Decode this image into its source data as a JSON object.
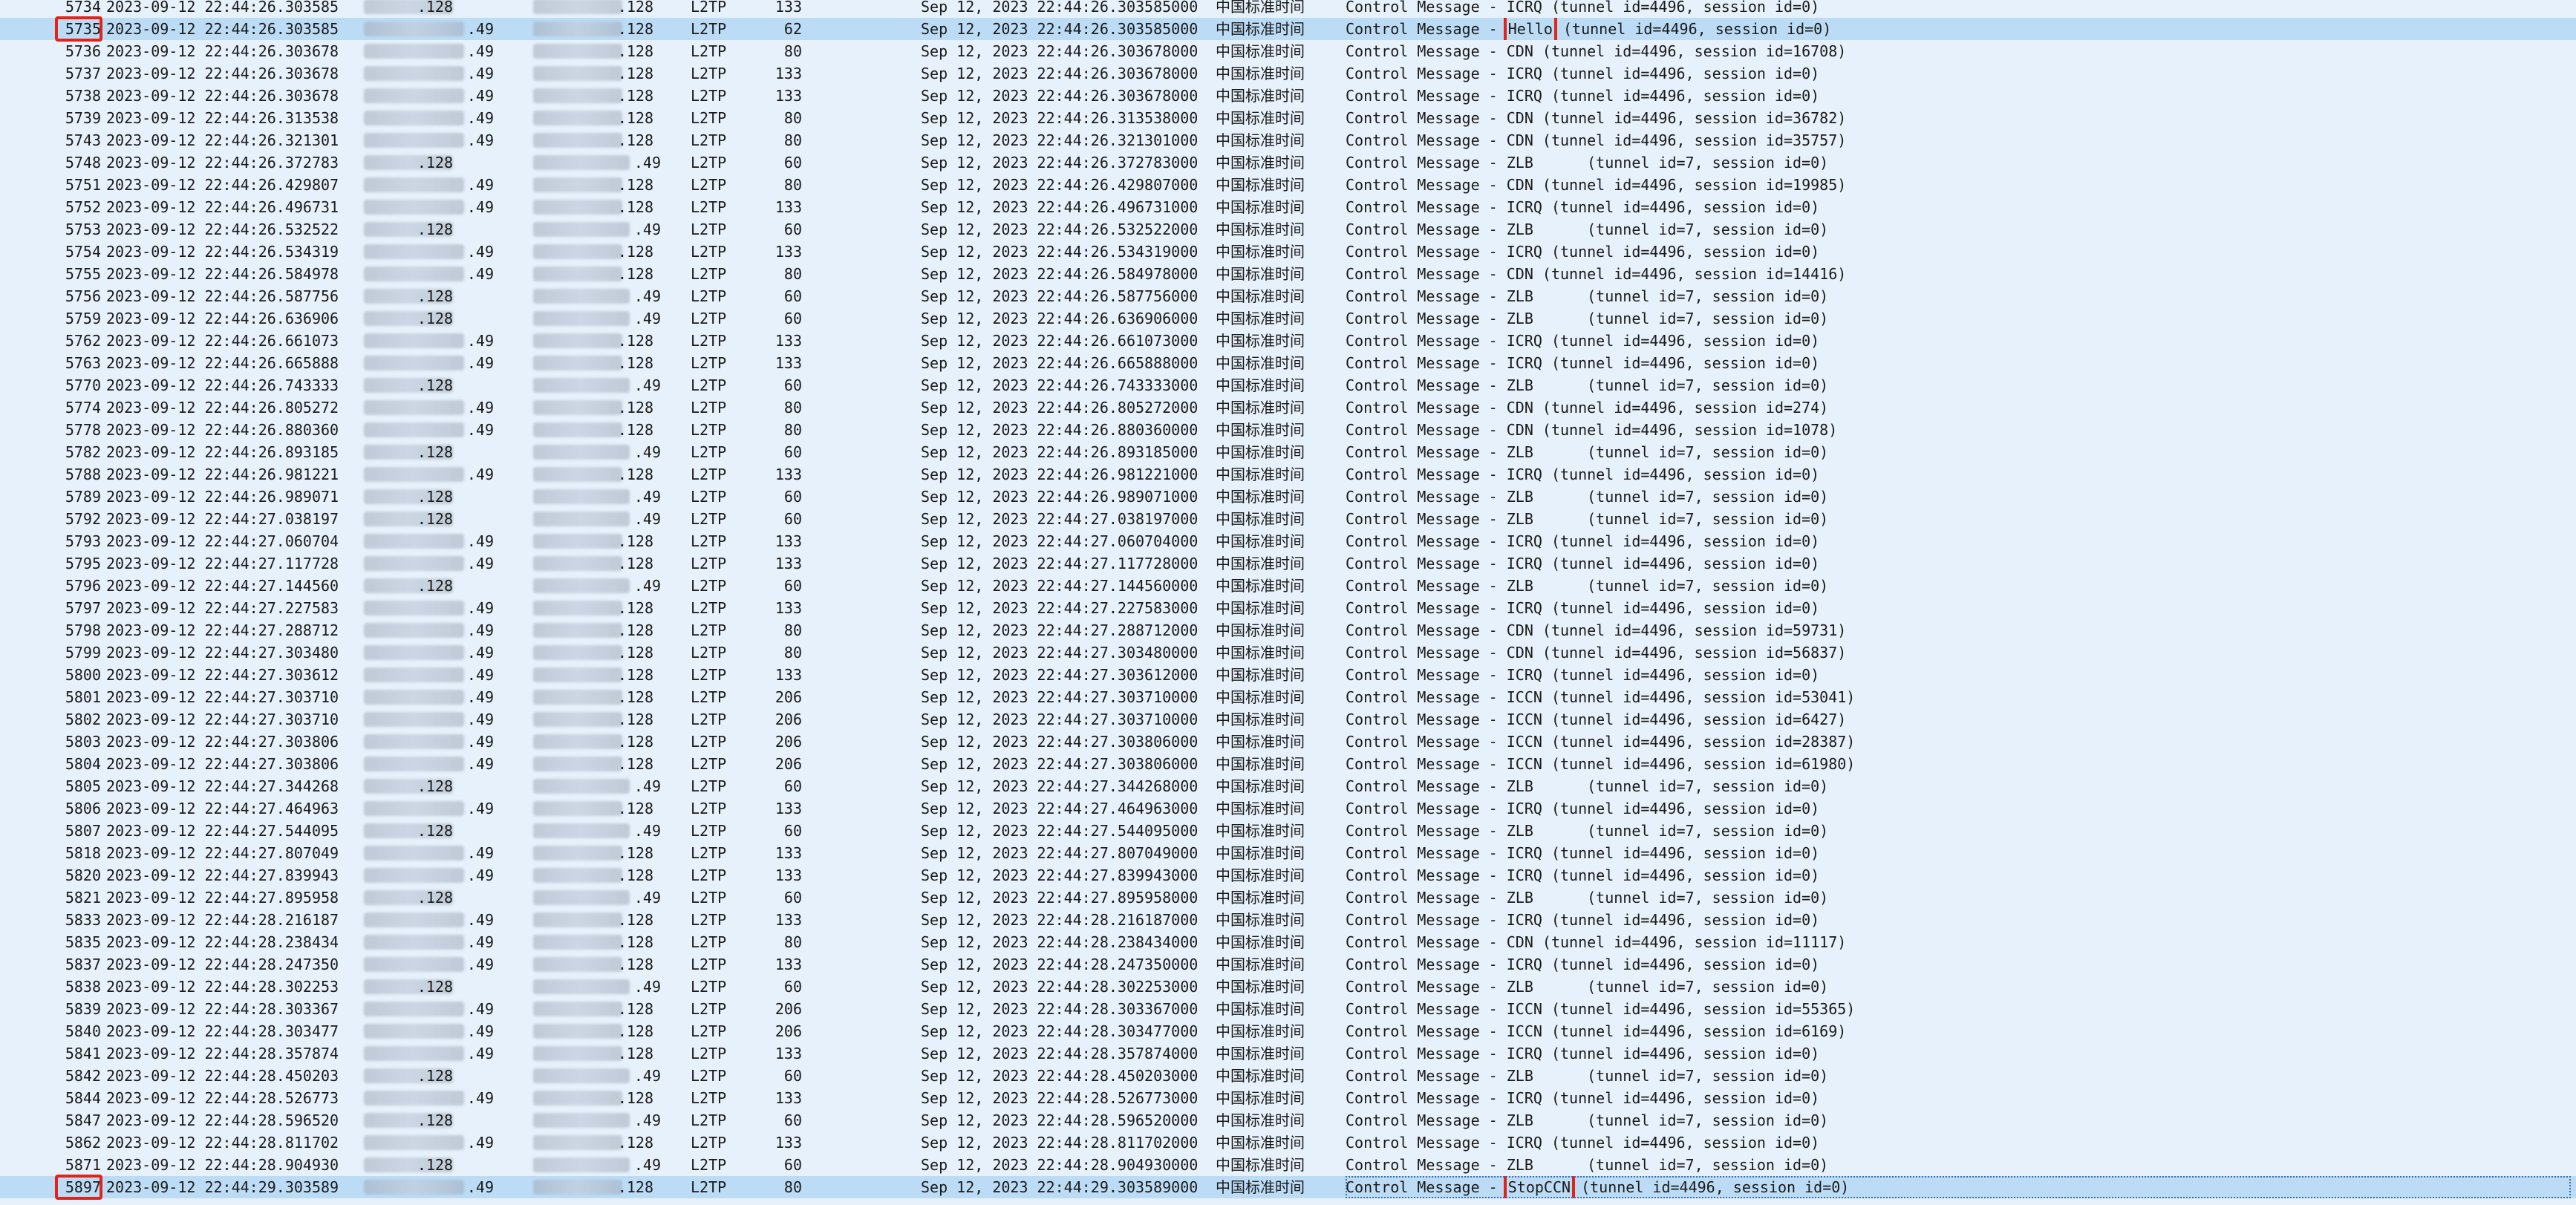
{
  "colors": {
    "background": "#e7f1fb",
    "selected_row": "#bcdcf6",
    "highlight_box": "#e2231a"
  },
  "common": {
    "protocol": "L2TP",
    "timezone": "中国标准时间",
    "date_prefix": "2023-09-12",
    "abs_prefix": "Sep 12, 2023"
  },
  "highlights": {
    "hello_message": "Hello",
    "stopccn_message": "StopCCN"
  },
  "rows": [
    {
      "no": "5734",
      "time": "2023-09-12 22:44:26.303585",
      "src": ".128",
      "dst": ".128",
      "proto": "L2TP",
      "len": "133",
      "abs": "Sep 12, 2023 22:44:26.303585000",
      "tz": "中国标准时间",
      "info": "Control Message - ICRQ (tunnel id=4496, session id=0)"
    },
    {
      "no": "5735",
      "time": "2023-09-12 22:44:26.303585",
      "src": ".49",
      "dst": ".128",
      "proto": "L2TP",
      "len": "62",
      "abs": "Sep 12, 2023 22:44:26.303585000",
      "tz": "中国标准时间",
      "info": "Control Message - Hello (tunnel id=4496, session id=0)"
    },
    {
      "no": "5736",
      "time": "2023-09-12 22:44:26.303678",
      "src": ".49",
      "dst": ".128",
      "proto": "L2TP",
      "len": "80",
      "abs": "Sep 12, 2023 22:44:26.303678000",
      "tz": "中国标准时间",
      "info": "Control Message - CDN (tunnel id=4496, session id=16708)"
    },
    {
      "no": "5737",
      "time": "2023-09-12 22:44:26.303678",
      "src": ".49",
      "dst": ".128",
      "proto": "L2TP",
      "len": "133",
      "abs": "Sep 12, 2023 22:44:26.303678000",
      "tz": "中国标准时间",
      "info": "Control Message - ICRQ (tunnel id=4496, session id=0)"
    },
    {
      "no": "5738",
      "time": "2023-09-12 22:44:26.303678",
      "src": ".49",
      "dst": ".128",
      "proto": "L2TP",
      "len": "133",
      "abs": "Sep 12, 2023 22:44:26.303678000",
      "tz": "中国标准时间",
      "info": "Control Message - ICRQ (tunnel id=4496, session id=0)"
    },
    {
      "no": "5739",
      "time": "2023-09-12 22:44:26.313538",
      "src": ".49",
      "dst": ".128",
      "proto": "L2TP",
      "len": "80",
      "abs": "Sep 12, 2023 22:44:26.313538000",
      "tz": "中国标准时间",
      "info": "Control Message - CDN (tunnel id=4496, session id=36782)"
    },
    {
      "no": "5743",
      "time": "2023-09-12 22:44:26.321301",
      "src": ".49",
      "dst": ".128",
      "proto": "L2TP",
      "len": "80",
      "abs": "Sep 12, 2023 22:44:26.321301000",
      "tz": "中国标准时间",
      "info": "Control Message - CDN (tunnel id=4496, session id=35757)"
    },
    {
      "no": "5748",
      "time": "2023-09-12 22:44:26.372783",
      "src": ".128",
      "dst": ".49",
      "proto": "L2TP",
      "len": "60",
      "abs": "Sep 12, 2023 22:44:26.372783000",
      "tz": "中国标准时间",
      "info": "Control Message - ZLB      (tunnel id=7, session id=0)"
    },
    {
      "no": "5751",
      "time": "2023-09-12 22:44:26.429807",
      "src": ".49",
      "dst": ".128",
      "proto": "L2TP",
      "len": "80",
      "abs": "Sep 12, 2023 22:44:26.429807000",
      "tz": "中国标准时间",
      "info": "Control Message - CDN (tunnel id=4496, session id=19985)"
    },
    {
      "no": "5752",
      "time": "2023-09-12 22:44:26.496731",
      "src": ".49",
      "dst": ".128",
      "proto": "L2TP",
      "len": "133",
      "abs": "Sep 12, 2023 22:44:26.496731000",
      "tz": "中国标准时间",
      "info": "Control Message - ICRQ (tunnel id=4496, session id=0)"
    },
    {
      "no": "5753",
      "time": "2023-09-12 22:44:26.532522",
      "src": ".128",
      "dst": ".49",
      "proto": "L2TP",
      "len": "60",
      "abs": "Sep 12, 2023 22:44:26.532522000",
      "tz": "中国标准时间",
      "info": "Control Message - ZLB      (tunnel id=7, session id=0)"
    },
    {
      "no": "5754",
      "time": "2023-09-12 22:44:26.534319",
      "src": ".49",
      "dst": ".128",
      "proto": "L2TP",
      "len": "133",
      "abs": "Sep 12, 2023 22:44:26.534319000",
      "tz": "中国标准时间",
      "info": "Control Message - ICRQ (tunnel id=4496, session id=0)"
    },
    {
      "no": "5755",
      "time": "2023-09-12 22:44:26.584978",
      "src": ".49",
      "dst": ".128",
      "proto": "L2TP",
      "len": "80",
      "abs": "Sep 12, 2023 22:44:26.584978000",
      "tz": "中国标准时间",
      "info": "Control Message - CDN (tunnel id=4496, session id=14416)"
    },
    {
      "no": "5756",
      "time": "2023-09-12 22:44:26.587756",
      "src": ".128",
      "dst": ".49",
      "proto": "L2TP",
      "len": "60",
      "abs": "Sep 12, 2023 22:44:26.587756000",
      "tz": "中国标准时间",
      "info": "Control Message - ZLB      (tunnel id=7, session id=0)"
    },
    {
      "no": "5759",
      "time": "2023-09-12 22:44:26.636906",
      "src": ".128",
      "dst": ".49",
      "proto": "L2TP",
      "len": "60",
      "abs": "Sep 12, 2023 22:44:26.636906000",
      "tz": "中国标准时间",
      "info": "Control Message - ZLB      (tunnel id=7, session id=0)"
    },
    {
      "no": "5762",
      "time": "2023-09-12 22:44:26.661073",
      "src": ".49",
      "dst": ".128",
      "proto": "L2TP",
      "len": "133",
      "abs": "Sep 12, 2023 22:44:26.661073000",
      "tz": "中国标准时间",
      "info": "Control Message - ICRQ (tunnel id=4496, session id=0)"
    },
    {
      "no": "5763",
      "time": "2023-09-12 22:44:26.665888",
      "src": ".49",
      "dst": ".128",
      "proto": "L2TP",
      "len": "133",
      "abs": "Sep 12, 2023 22:44:26.665888000",
      "tz": "中国标准时间",
      "info": "Control Message - ICRQ (tunnel id=4496, session id=0)"
    },
    {
      "no": "5770",
      "time": "2023-09-12 22:44:26.743333",
      "src": ".128",
      "dst": ".49",
      "proto": "L2TP",
      "len": "60",
      "abs": "Sep 12, 2023 22:44:26.743333000",
      "tz": "中国标准时间",
      "info": "Control Message - ZLB      (tunnel id=7, session id=0)"
    },
    {
      "no": "5774",
      "time": "2023-09-12 22:44:26.805272",
      "src": ".49",
      "dst": ".128",
      "proto": "L2TP",
      "len": "80",
      "abs": "Sep 12, 2023 22:44:26.805272000",
      "tz": "中国标准时间",
      "info": "Control Message - CDN (tunnel id=4496, session id=274)"
    },
    {
      "no": "5778",
      "time": "2023-09-12 22:44:26.880360",
      "src": ".49",
      "dst": ".128",
      "proto": "L2TP",
      "len": "80",
      "abs": "Sep 12, 2023 22:44:26.880360000",
      "tz": "中国标准时间",
      "info": "Control Message - CDN (tunnel id=4496, session id=1078)"
    },
    {
      "no": "5782",
      "time": "2023-09-12 22:44:26.893185",
      "src": ".128",
      "dst": ".49",
      "proto": "L2TP",
      "len": "60",
      "abs": "Sep 12, 2023 22:44:26.893185000",
      "tz": "中国标准时间",
      "info": "Control Message - ZLB      (tunnel id=7, session id=0)"
    },
    {
      "no": "5788",
      "time": "2023-09-12 22:44:26.981221",
      "src": ".49",
      "dst": ".128",
      "proto": "L2TP",
      "len": "133",
      "abs": "Sep 12, 2023 22:44:26.981221000",
      "tz": "中国标准时间",
      "info": "Control Message - ICRQ (tunnel id=4496, session id=0)"
    },
    {
      "no": "5789",
      "time": "2023-09-12 22:44:26.989071",
      "src": ".128",
      "dst": ".49",
      "proto": "L2TP",
      "len": "60",
      "abs": "Sep 12, 2023 22:44:26.989071000",
      "tz": "中国标准时间",
      "info": "Control Message - ZLB      (tunnel id=7, session id=0)"
    },
    {
      "no": "5792",
      "time": "2023-09-12 22:44:27.038197",
      "src": ".128",
      "dst": ".49",
      "proto": "L2TP",
      "len": "60",
      "abs": "Sep 12, 2023 22:44:27.038197000",
      "tz": "中国标准时间",
      "info": "Control Message - ZLB      (tunnel id=7, session id=0)"
    },
    {
      "no": "5793",
      "time": "2023-09-12 22:44:27.060704",
      "src": ".49",
      "dst": ".128",
      "proto": "L2TP",
      "len": "133",
      "abs": "Sep 12, 2023 22:44:27.060704000",
      "tz": "中国标准时间",
      "info": "Control Message - ICRQ (tunnel id=4496, session id=0)"
    },
    {
      "no": "5795",
      "time": "2023-09-12 22:44:27.117728",
      "src": ".49",
      "dst": ".128",
      "proto": "L2TP",
      "len": "133",
      "abs": "Sep 12, 2023 22:44:27.117728000",
      "tz": "中国标准时间",
      "info": "Control Message - ICRQ (tunnel id=4496, session id=0)"
    },
    {
      "no": "5796",
      "time": "2023-09-12 22:44:27.144560",
      "src": ".128",
      "dst": ".49",
      "proto": "L2TP",
      "len": "60",
      "abs": "Sep 12, 2023 22:44:27.144560000",
      "tz": "中国标准时间",
      "info": "Control Message - ZLB      (tunnel id=7, session id=0)"
    },
    {
      "no": "5797",
      "time": "2023-09-12 22:44:27.227583",
      "src": ".49",
      "dst": ".128",
      "proto": "L2TP",
      "len": "133",
      "abs": "Sep 12, 2023 22:44:27.227583000",
      "tz": "中国标准时间",
      "info": "Control Message - ICRQ (tunnel id=4496, session id=0)"
    },
    {
      "no": "5798",
      "time": "2023-09-12 22:44:27.288712",
      "src": ".49",
      "dst": ".128",
      "proto": "L2TP",
      "len": "80",
      "abs": "Sep 12, 2023 22:44:27.288712000",
      "tz": "中国标准时间",
      "info": "Control Message - CDN (tunnel id=4496, session id=59731)"
    },
    {
      "no": "5799",
      "time": "2023-09-12 22:44:27.303480",
      "src": ".49",
      "dst": ".128",
      "proto": "L2TP",
      "len": "80",
      "abs": "Sep 12, 2023 22:44:27.303480000",
      "tz": "中国标准时间",
      "info": "Control Message - CDN (tunnel id=4496, session id=56837)"
    },
    {
      "no": "5800",
      "time": "2023-09-12 22:44:27.303612",
      "src": ".49",
      "dst": ".128",
      "proto": "L2TP",
      "len": "133",
      "abs": "Sep 12, 2023 22:44:27.303612000",
      "tz": "中国标准时间",
      "info": "Control Message - ICRQ (tunnel id=4496, session id=0)"
    },
    {
      "no": "5801",
      "time": "2023-09-12 22:44:27.303710",
      "src": ".49",
      "dst": ".128",
      "proto": "L2TP",
      "len": "206",
      "abs": "Sep 12, 2023 22:44:27.303710000",
      "tz": "中国标准时间",
      "info": "Control Message - ICCN (tunnel id=4496, session id=53041)"
    },
    {
      "no": "5802",
      "time": "2023-09-12 22:44:27.303710",
      "src": ".49",
      "dst": ".128",
      "proto": "L2TP",
      "len": "206",
      "abs": "Sep 12, 2023 22:44:27.303710000",
      "tz": "中国标准时间",
      "info": "Control Message - ICCN (tunnel id=4496, session id=6427)"
    },
    {
      "no": "5803",
      "time": "2023-09-12 22:44:27.303806",
      "src": ".49",
      "dst": ".128",
      "proto": "L2TP",
      "len": "206",
      "abs": "Sep 12, 2023 22:44:27.303806000",
      "tz": "中国标准时间",
      "info": "Control Message - ICCN (tunnel id=4496, session id=28387)"
    },
    {
      "no": "5804",
      "time": "2023-09-12 22:44:27.303806",
      "src": ".49",
      "dst": ".128",
      "proto": "L2TP",
      "len": "206",
      "abs": "Sep 12, 2023 22:44:27.303806000",
      "tz": "中国标准时间",
      "info": "Control Message - ICCN (tunnel id=4496, session id=61980)"
    },
    {
      "no": "5805",
      "time": "2023-09-12 22:44:27.344268",
      "src": ".128",
      "dst": ".49",
      "proto": "L2TP",
      "len": "60",
      "abs": "Sep 12, 2023 22:44:27.344268000",
      "tz": "中国标准时间",
      "info": "Control Message - ZLB      (tunnel id=7, session id=0)"
    },
    {
      "no": "5806",
      "time": "2023-09-12 22:44:27.464963",
      "src": ".49",
      "dst": ".128",
      "proto": "L2TP",
      "len": "133",
      "abs": "Sep 12, 2023 22:44:27.464963000",
      "tz": "中国标准时间",
      "info": "Control Message - ICRQ (tunnel id=4496, session id=0)"
    },
    {
      "no": "5807",
      "time": "2023-09-12 22:44:27.544095",
      "src": ".128",
      "dst": ".49",
      "proto": "L2TP",
      "len": "60",
      "abs": "Sep 12, 2023 22:44:27.544095000",
      "tz": "中国标准时间",
      "info": "Control Message - ZLB      (tunnel id=7, session id=0)"
    },
    {
      "no": "5818",
      "time": "2023-09-12 22:44:27.807049",
      "src": ".49",
      "dst": ".128",
      "proto": "L2TP",
      "len": "133",
      "abs": "Sep 12, 2023 22:44:27.807049000",
      "tz": "中国标准时间",
      "info": "Control Message - ICRQ (tunnel id=4496, session id=0)"
    },
    {
      "no": "5820",
      "time": "2023-09-12 22:44:27.839943",
      "src": ".49",
      "dst": ".128",
      "proto": "L2TP",
      "len": "133",
      "abs": "Sep 12, 2023 22:44:27.839943000",
      "tz": "中国标准时间",
      "info": "Control Message - ICRQ (tunnel id=4496, session id=0)"
    },
    {
      "no": "5821",
      "time": "2023-09-12 22:44:27.895958",
      "src": ".128",
      "dst": ".49",
      "proto": "L2TP",
      "len": "60",
      "abs": "Sep 12, 2023 22:44:27.895958000",
      "tz": "中国标准时间",
      "info": "Control Message - ZLB      (tunnel id=7, session id=0)"
    },
    {
      "no": "5833",
      "time": "2023-09-12 22:44:28.216187",
      "src": ".49",
      "dst": ".128",
      "proto": "L2TP",
      "len": "133",
      "abs": "Sep 12, 2023 22:44:28.216187000",
      "tz": "中国标准时间",
      "info": "Control Message - ICRQ (tunnel id=4496, session id=0)"
    },
    {
      "no": "5835",
      "time": "2023-09-12 22:44:28.238434",
      "src": ".49",
      "dst": ".128",
      "proto": "L2TP",
      "len": "80",
      "abs": "Sep 12, 2023 22:44:28.238434000",
      "tz": "中国标准时间",
      "info": "Control Message - CDN (tunnel id=4496, session id=11117)"
    },
    {
      "no": "5837",
      "time": "2023-09-12 22:44:28.247350",
      "src": ".49",
      "dst": ".128",
      "proto": "L2TP",
      "len": "133",
      "abs": "Sep 12, 2023 22:44:28.247350000",
      "tz": "中国标准时间",
      "info": "Control Message - ICRQ (tunnel id=4496, session id=0)"
    },
    {
      "no": "5838",
      "time": "2023-09-12 22:44:28.302253",
      "src": ".128",
      "dst": ".49",
      "proto": "L2TP",
      "len": "60",
      "abs": "Sep 12, 2023 22:44:28.302253000",
      "tz": "中国标准时间",
      "info": "Control Message - ZLB      (tunnel id=7, session id=0)"
    },
    {
      "no": "5839",
      "time": "2023-09-12 22:44:28.303367",
      "src": ".49",
      "dst": ".128",
      "proto": "L2TP",
      "len": "206",
      "abs": "Sep 12, 2023 22:44:28.303367000",
      "tz": "中国标准时间",
      "info": "Control Message - ICCN (tunnel id=4496, session id=55365)"
    },
    {
      "no": "5840",
      "time": "2023-09-12 22:44:28.303477",
      "src": ".49",
      "dst": ".128",
      "proto": "L2TP",
      "len": "206",
      "abs": "Sep 12, 2023 22:44:28.303477000",
      "tz": "中国标准时间",
      "info": "Control Message - ICCN (tunnel id=4496, session id=6169)"
    },
    {
      "no": "5841",
      "time": "2023-09-12 22:44:28.357874",
      "src": ".49",
      "dst": ".128",
      "proto": "L2TP",
      "len": "133",
      "abs": "Sep 12, 2023 22:44:28.357874000",
      "tz": "中国标准时间",
      "info": "Control Message - ICRQ (tunnel id=4496, session id=0)"
    },
    {
      "no": "5842",
      "time": "2023-09-12 22:44:28.450203",
      "src": ".128",
      "dst": ".49",
      "proto": "L2TP",
      "len": "60",
      "abs": "Sep 12, 2023 22:44:28.450203000",
      "tz": "中国标准时间",
      "info": "Control Message - ZLB      (tunnel id=7, session id=0)"
    },
    {
      "no": "5844",
      "time": "2023-09-12 22:44:28.526773",
      "src": ".49",
      "dst": ".128",
      "proto": "L2TP",
      "len": "133",
      "abs": "Sep 12, 2023 22:44:28.526773000",
      "tz": "中国标准时间",
      "info": "Control Message - ICRQ (tunnel id=4496, session id=0)"
    },
    {
      "no": "5847",
      "time": "2023-09-12 22:44:28.596520",
      "src": ".128",
      "dst": ".49",
      "proto": "L2TP",
      "len": "60",
      "abs": "Sep 12, 2023 22:44:28.596520000",
      "tz": "中国标准时间",
      "info": "Control Message - ZLB      (tunnel id=7, session id=0)"
    },
    {
      "no": "5862",
      "time": "2023-09-12 22:44:28.811702",
      "src": ".49",
      "dst": ".128",
      "proto": "L2TP",
      "len": "133",
      "abs": "Sep 12, 2023 22:44:28.811702000",
      "tz": "中国标准时间",
      "info": "Control Message - ICRQ (tunnel id=4496, session id=0)"
    },
    {
      "no": "5871",
      "time": "2023-09-12 22:44:28.904930",
      "src": ".128",
      "dst": ".49",
      "proto": "L2TP",
      "len": "60",
      "abs": "Sep 12, 2023 22:44:28.904930000",
      "tz": "中国标准时间",
      "info": "Control Message - ZLB      (tunnel id=7, session id=0)"
    },
    {
      "no": "5897",
      "time": "2023-09-12 22:44:29.303589",
      "src": ".49",
      "dst": ".128",
      "proto": "L2TP",
      "len": "80",
      "abs": "Sep 12, 2023 22:44:29.303589000",
      "tz": "中国标准时间",
      "info": "Control Message - StopCCN (tunnel id=4496, session id=0)"
    }
  ]
}
